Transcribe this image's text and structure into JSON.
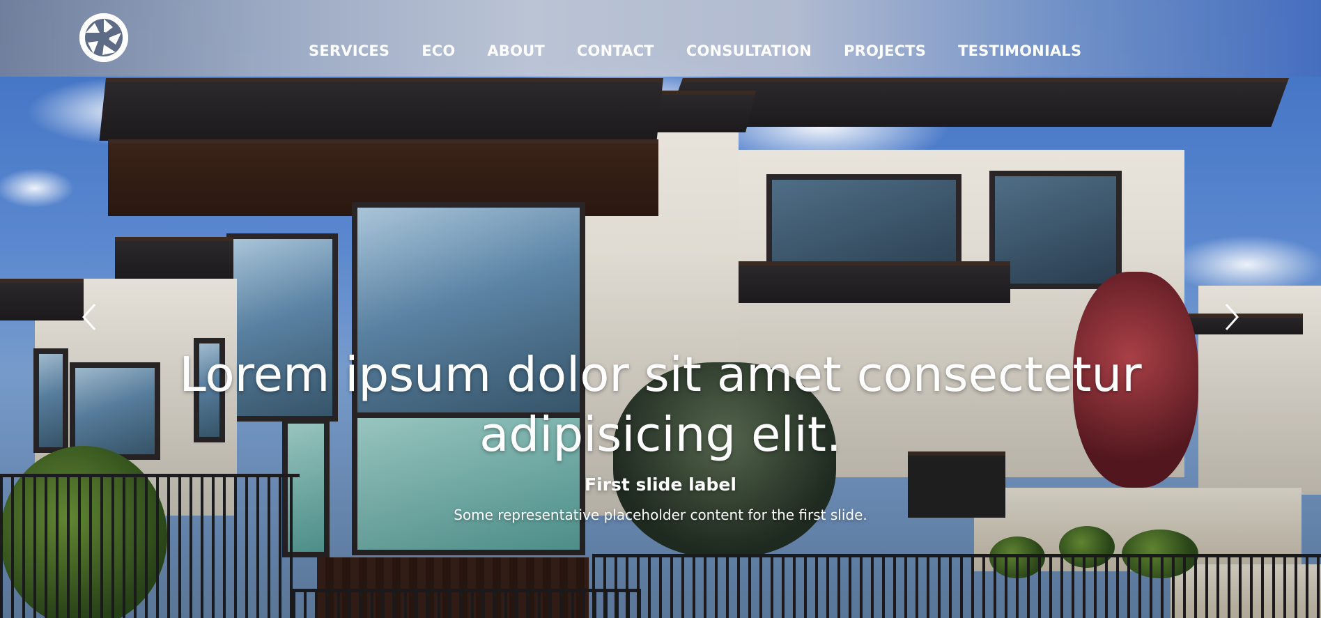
{
  "navbar": {
    "logo_icon": "aperture-logo-icon",
    "items": [
      {
        "label": "SERVICES"
      },
      {
        "label": "ECO"
      },
      {
        "label": "ABOUT"
      },
      {
        "label": "CONTACT"
      },
      {
        "label": "CONSULTATION"
      },
      {
        "label": "PROJECTS"
      },
      {
        "label": "TESTIMONIALS"
      }
    ]
  },
  "carousel": {
    "prev_icon": "chevron-left-icon",
    "next_icon": "chevron-right-icon",
    "slide": {
      "headline": "Lorem ipsum dolor sit amet consectetur adipisicing elit.",
      "label": "First slide label",
      "text": "Some representative placeholder content for the first slide."
    }
  },
  "colors": {
    "nav_text": "#ffffff",
    "caption_text": "#ffffff",
    "sky": "#3c6ec2"
  }
}
